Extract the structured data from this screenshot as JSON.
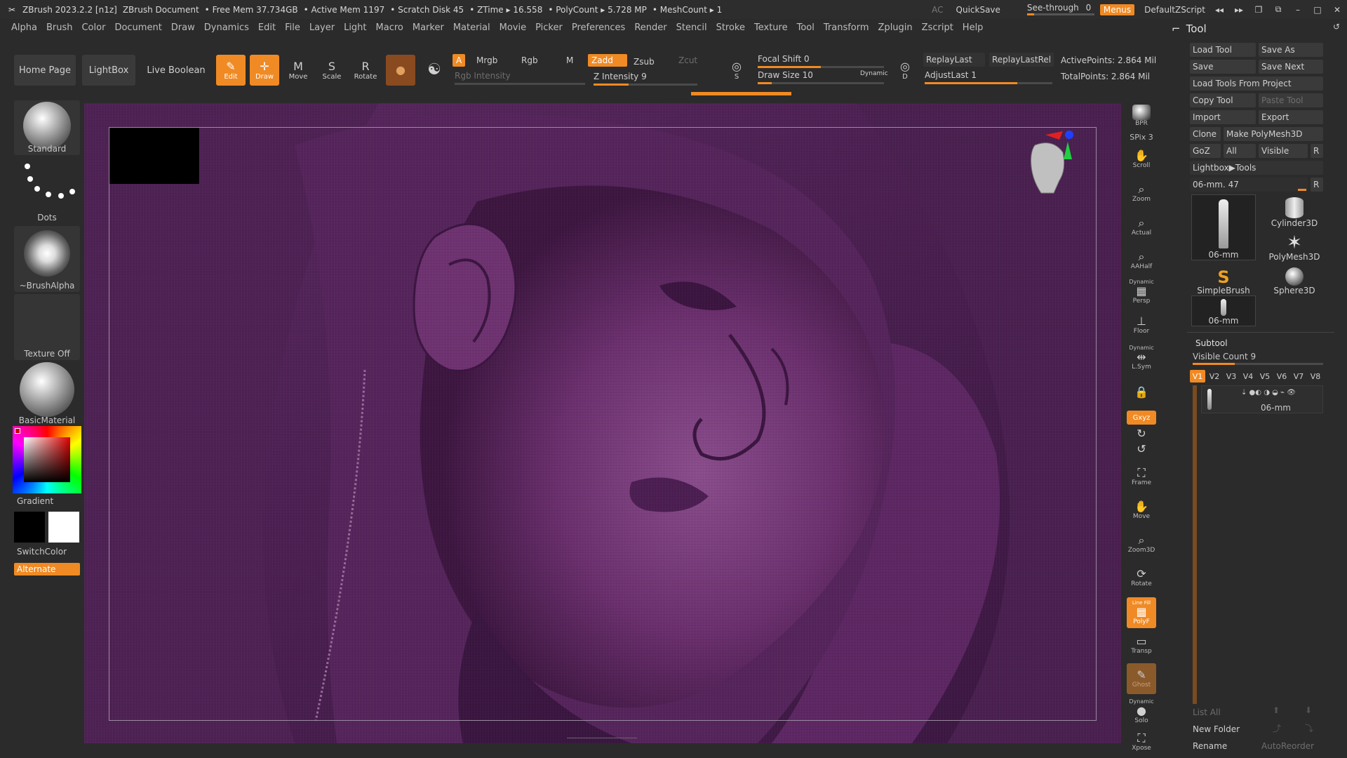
{
  "titlebar": {
    "app": "ZBrush 2023.2.2 [n1z]",
    "document": "ZBrush Document",
    "free_mem": "• Free Mem 37.734GB",
    "active_mem": "• Active Mem 1197",
    "scratch": "• Scratch Disk 45",
    "ztime": "• ZTime ▸ 16.558",
    "polycount": "• PolyCount ▸ 5.728 MP",
    "meshcount": "• MeshCount ▸ 1",
    "ac": "AC",
    "quicksave": "QuickSave",
    "see_through": "See-through",
    "see_through_value": "0",
    "menus": "Menus",
    "script": "DefaultZScript"
  },
  "menubar": [
    "Alpha",
    "Brush",
    "Color",
    "Document",
    "Draw",
    "Dynamics",
    "Edit",
    "File",
    "Layer",
    "Light",
    "Macro",
    "Marker",
    "Material",
    "Movie",
    "Picker",
    "Preferences",
    "Render",
    "Stencil",
    "Stroke",
    "Texture",
    "Tool",
    "Transform",
    "Zplugin",
    "Zscript",
    "Help"
  ],
  "toolbar": {
    "home_page": "Home Page",
    "lightbox": "LightBox",
    "live_boolean": "Live Boolean",
    "edit": "Edit",
    "draw": "Draw",
    "move": "Move",
    "scale": "Scale",
    "rotate": "Rotate",
    "a": "A",
    "mrgb": "Mrgb",
    "rgb": "Rgb",
    "m": "M",
    "zadd": "Zadd",
    "zsub": "Zsub",
    "zcut": "Zcut",
    "rgb_intensity": "Rgb Intensity",
    "z_intensity": "Z Intensity 9",
    "focal_shift": "Focal Shift 0",
    "draw_size": "Draw Size 10",
    "dynamic": "Dynamic",
    "replay_last": "ReplayLast",
    "replay_last_rel": "ReplayLastRel",
    "adjust_last": "AdjustLast 1",
    "active_points": "ActivePoints: 2.864 Mil",
    "total_points": "TotalPoints: 2.864 Mil",
    "s_label": "S",
    "d_label": "D"
  },
  "leftshelf": {
    "standard": "Standard",
    "dots": "Dots",
    "brush_alpha": "~BrushAlpha",
    "texture_off": "Texture Off",
    "basic_material": "BasicMaterial",
    "gradient": "Gradient",
    "switch_color": "SwitchColor",
    "alternate": "Alternate"
  },
  "rightstrip": {
    "bpr": "BPR",
    "spix": "SPix 3",
    "scroll": "Scroll",
    "zoom": "Zoom",
    "actual": "Actual",
    "aahalf": "AAHalf",
    "persp": "Persp",
    "floor": "Floor",
    "lsym": "L.Sym",
    "xyz": "Gxyz",
    "frame": "Frame",
    "move": "Move",
    "zoom3d": "Zoom3D",
    "rotate": "Rotate",
    "polyf": "PolyF",
    "transp": "Transp",
    "ghost": "Ghost",
    "solo": "Solo",
    "xpose": "Xpose",
    "dynamic": "Dynamic",
    "line_fill": "Line Fill"
  },
  "toolpanel": {
    "title": "Tool",
    "load_tool": "Load Tool",
    "save_as": "Save As",
    "save": "Save",
    "save_next": "Save Next",
    "load_from_project": "Load Tools From Project",
    "copy_tool": "Copy Tool",
    "paste_tool": "Paste Tool",
    "import": "Import",
    "export": "Export",
    "clone": "Clone",
    "make_polymesh": "Make PolyMesh3D",
    "goz": "GoZ",
    "all": "All",
    "visible": "Visible",
    "r": "R",
    "lightbox_tools": "Lightbox▶Tools",
    "current_tool": "06-mm. 47",
    "thumbs": [
      "06-mm",
      "Cylinder3D",
      "PolyMesh3D",
      "SimpleBrush",
      "Sphere3D",
      "06-mm"
    ],
    "subtool": "Subtool",
    "visible_count": "Visible Count 9",
    "versions": [
      "V1",
      "V2",
      "V3",
      "V4",
      "V5",
      "V6",
      "V7",
      "V8"
    ],
    "subtool_item": "06-mm",
    "list_all": "List All",
    "new_folder": "New Folder",
    "rename": "Rename",
    "auto_reorder": "AutoReorder"
  },
  "colors": {
    "accent": "#f08a24",
    "sculpt_purple": "#6b2f6e"
  }
}
